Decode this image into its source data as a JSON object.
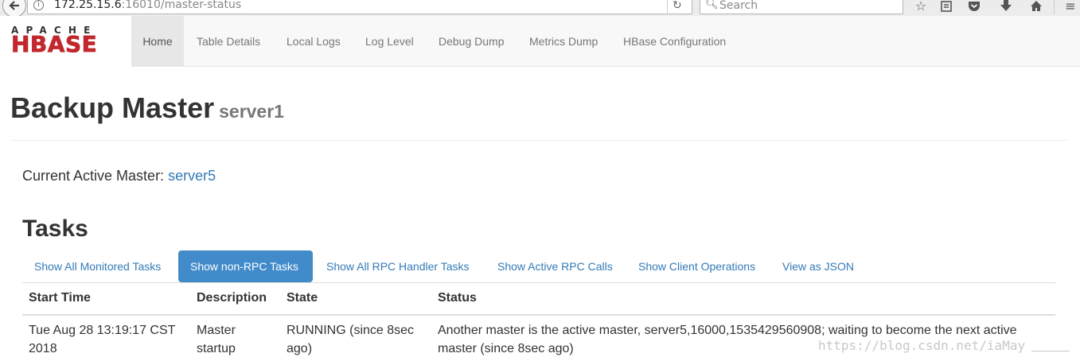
{
  "browser": {
    "url_host": "172.25.15.6",
    "url_rest": ":16010/master-status",
    "search_placeholder": "Search"
  },
  "navbar": {
    "logo_top": "APACHE",
    "logo_main": "HBASE",
    "items": [
      {
        "label": "Home",
        "active": true
      },
      {
        "label": "Table Details"
      },
      {
        "label": "Local Logs"
      },
      {
        "label": "Log Level"
      },
      {
        "label": "Debug Dump"
      },
      {
        "label": "Metrics Dump"
      },
      {
        "label": "HBase Configuration"
      }
    ]
  },
  "page": {
    "title": "Backup Master",
    "subtitle": "server1",
    "active_master_label": "Current Active Master:",
    "active_master_value": "server5"
  },
  "tasks": {
    "heading": "Tasks",
    "tabs": [
      {
        "label": "Show All Monitored Tasks"
      },
      {
        "label": "Show non-RPC Tasks",
        "active": true
      },
      {
        "label": "Show All RPC Handler Tasks"
      },
      {
        "label": "Show Active RPC Calls"
      },
      {
        "label": "Show Client Operations"
      },
      {
        "label": "View as JSON"
      }
    ],
    "columns": [
      "Start Time",
      "Description",
      "State",
      "Status"
    ],
    "rows": [
      {
        "start_time": "Tue Aug 28 13:19:17 CST 2018",
        "description": "Master startup",
        "state": "RUNNING (since 8sec ago)",
        "status": "Another master is the active master, server5,16000,1535429560908; waiting to become the next active master (since 8sec ago)"
      }
    ]
  },
  "watermark": "https://blog.csdn.net/iaMay",
  "colors": {
    "link": "#337ab7",
    "active_pill": "#428bca",
    "logo_red": "#c1272d"
  }
}
